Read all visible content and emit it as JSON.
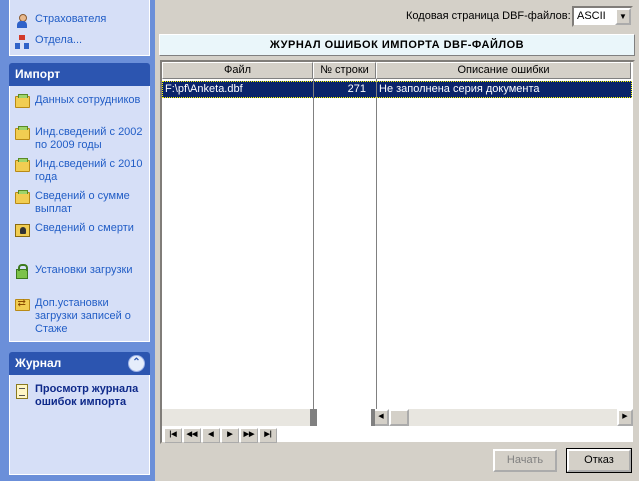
{
  "sidebar": {
    "top_items": [
      {
        "label": "Страхователя",
        "icon": "user-icon"
      },
      {
        "label": "Отдела...",
        "icon": "org-icon"
      }
    ],
    "import_panel": {
      "title": "Импорт",
      "items": [
        {
          "label": "Данных сотрудников",
          "icon": "folder-icon"
        },
        {
          "label": "Инд.сведений с 2002 по 2009 годы",
          "icon": "folder-icon"
        },
        {
          "label": "Инд.сведений с 2010 года",
          "icon": "folder-icon"
        },
        {
          "label": "Сведений о сумме выплат",
          "icon": "folder-icon"
        },
        {
          "label": "Сведений о смерти",
          "icon": "death-icon"
        },
        {
          "label": "Установки загрузки",
          "icon": "lock-icon"
        },
        {
          "label": "Доп.установки загрузки записей о Стаже",
          "icon": "settings-folder-icon"
        }
      ]
    },
    "journal_panel": {
      "title": "Журнал",
      "items": [
        {
          "label": "Просмотр журнала ошибок импорта",
          "icon": "journal-icon"
        }
      ]
    }
  },
  "codepage": {
    "label": "Кодовая страница DBF-файлов:",
    "value": "ASCII"
  },
  "log": {
    "title": "ЖУРНАЛ ОШИБОК ИМПОРТА DBF-ФАЙЛОВ",
    "columns": [
      "Файл",
      "№ строки",
      "Описание ошибки"
    ],
    "rows": [
      {
        "file": "F:\\pf\\Anketa.dbf",
        "row": "271",
        "description": "Не заполнена серия документа"
      }
    ]
  },
  "buttons": {
    "start": "Начать",
    "cancel": "Отказ"
  }
}
